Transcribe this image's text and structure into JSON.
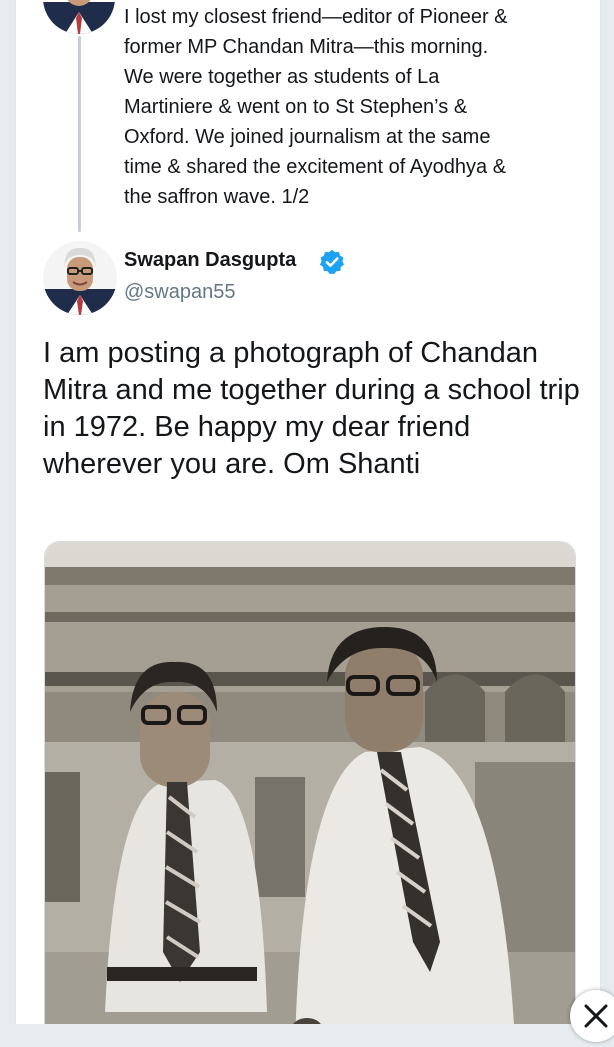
{
  "thread_tweet": {
    "text": "I lost my closest friend—editor of Pioneer &\nformer MP Chandan Mitra—this morning.\nWe were together as students of La\nMartiniere & went on to St Stephen’s &\nOxford. We joined journalism at the same\ntime & shared the excitement of Ayodhya &\nthe saffron wave. 1/2",
    "avatar_icon": "profile-photo"
  },
  "main_tweet": {
    "author_name": "Swapan Dasgupta",
    "author_handle": "@swapan55",
    "verified_icon": "verified-badge-icon",
    "text": "I am posting a photograph of Chandan Mitra and me together during a school trip in 1972. Be happy my dear friend wherever you are. Om Shanti",
    "photo_icon": "attached-photo"
  },
  "close_button": {
    "icon": "close-icon"
  },
  "colors": {
    "page_bg": "#e6ecf0",
    "card_bg": "#ffffff",
    "text": "#14171a",
    "secondary_text": "#657786",
    "verified_blue": "#1da1f2",
    "thread_line": "#c4cfd6"
  }
}
